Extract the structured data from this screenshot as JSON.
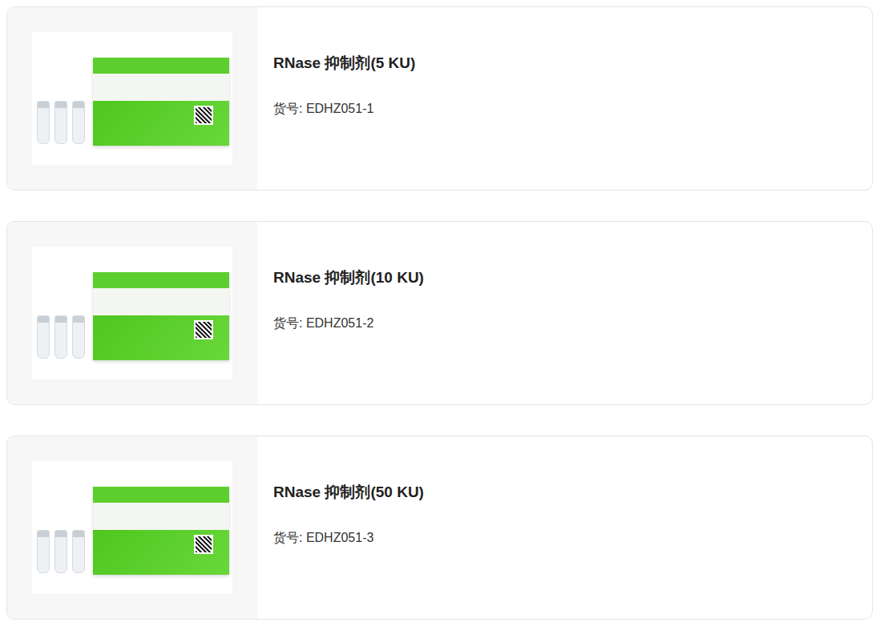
{
  "products": [
    {
      "title": "RNase 抑制剂(5 KU)",
      "sku": "货号: EDHZ051-1"
    },
    {
      "title": "RNase 抑制剂(10 KU)",
      "sku": "货号: EDHZ051-2"
    },
    {
      "title": "RNase 抑制剂(50 KU)",
      "sku": "货号: EDHZ051-3"
    }
  ]
}
